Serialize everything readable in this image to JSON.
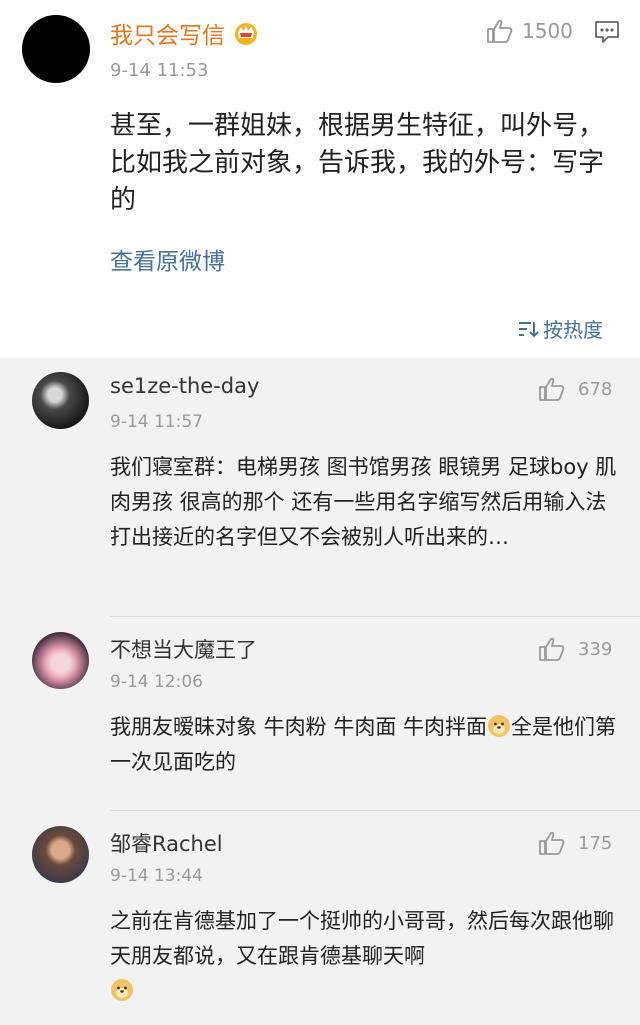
{
  "main_post": {
    "username": "我只会写信",
    "time": "9-14 11:53",
    "likes": "1500",
    "text": "甚至，一群姐妹，根据男生特征，叫外号，比如我之前对象，告诉我，我的外号：写字的",
    "view_original": "查看原微博",
    "sort_label": "按热度"
  },
  "replies": [
    {
      "username": "se1ze-the-day",
      "time": "9-14 11:57",
      "likes": "678",
      "text": "我们寝室群：电梯男孩 图书馆男孩 眼镜男 足球boy 肌肉男孩 很高的那个  还有一些用名字缩写然后用输入法打出接近的名字但又不会被别人听出来的…"
    },
    {
      "username": "不想当大魔王了",
      "time": "9-14 12:06",
      "likes": "339",
      "text_before_emoji": "我朋友暧昧对象 牛肉粉 牛肉面 牛肉拌面",
      "text_after_emoji": "全是他们第一次见面吃的"
    },
    {
      "username": "邹睿Rachel",
      "time": "9-14 13:44",
      "likes": "175",
      "text": "之前在肯德基加了一个挺帅的小哥哥，然后每次跟他聊天朋友都说，又在跟肯德基聊天啊"
    }
  ],
  "colors": {
    "username_orange": "#e8751a",
    "link_blue": "#46709e",
    "meta_gray": "#9a9a9a",
    "page_bg": "#f2f2f2"
  },
  "icons": [
    "crown-badge-icon",
    "thumbs-up-icon",
    "comment-icon",
    "sort-icon",
    "doge-emoji-icon"
  ]
}
